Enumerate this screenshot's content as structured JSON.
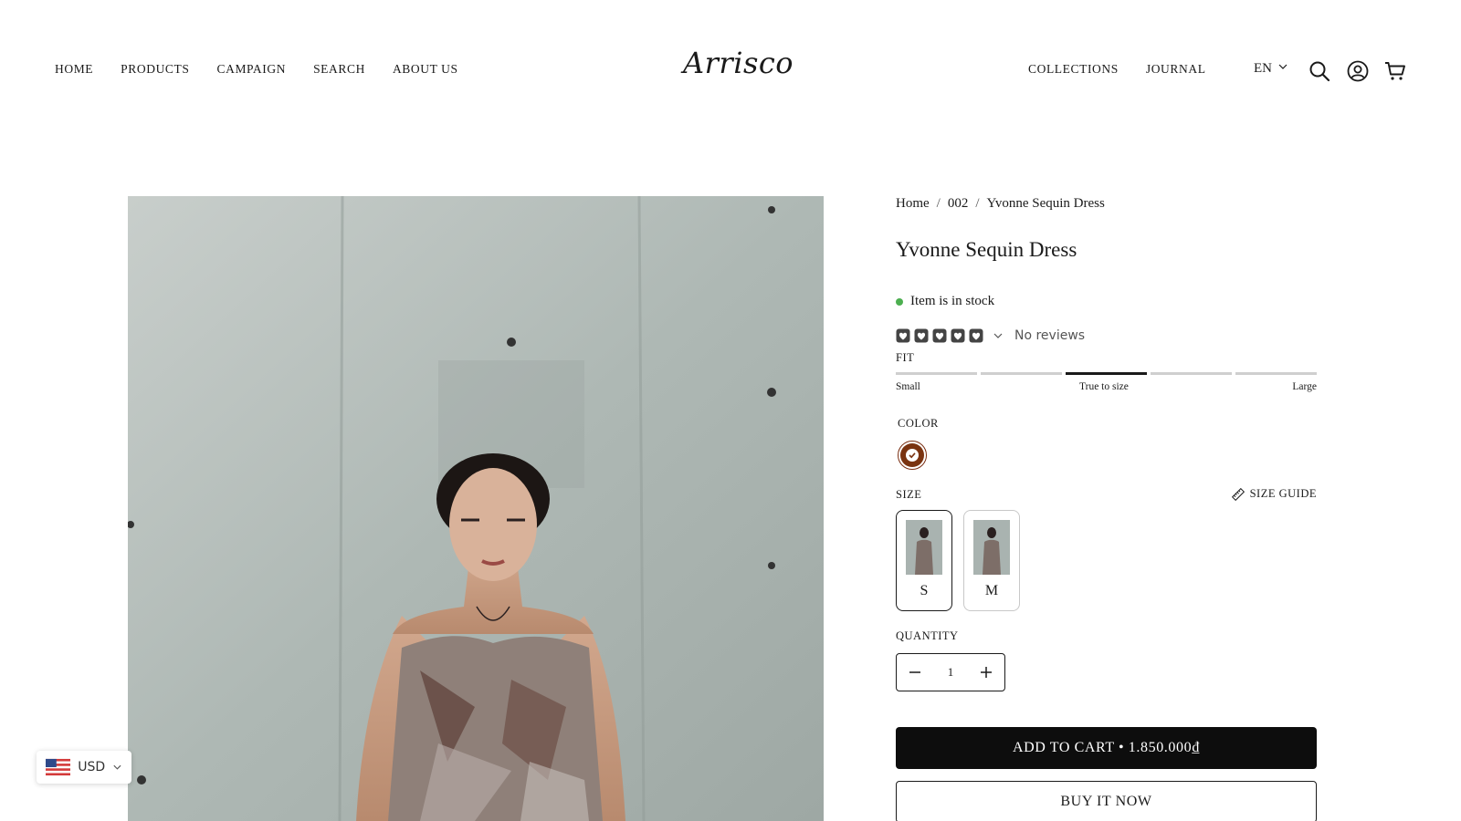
{
  "header": {
    "nav_left": [
      "HOME",
      "PRODUCTS",
      "CAMPAIGN",
      "SEARCH",
      "ABOUT US"
    ],
    "logo": "Arrisco",
    "nav_right": [
      "COLLECTIONS",
      "JOURNAL"
    ],
    "language": "EN",
    "icons": [
      "search-icon",
      "account-icon",
      "cart-icon"
    ]
  },
  "breadcrumb": {
    "home": "Home",
    "separator": "/",
    "collection": "002",
    "current": "Yvonne Sequin Dress"
  },
  "product": {
    "title": "Yvonne Sequin Dress",
    "stock_status": "Item is in stock",
    "rating_text": "No reviews",
    "rating_icon": "heart-icon",
    "fit": {
      "label": "FIT",
      "segments": 5,
      "selected_segment": 3,
      "scale_left": "Small",
      "scale_mid": "True to size",
      "scale_right": "Large"
    },
    "color": {
      "label": "COLOR",
      "swatch_hex": "#7a3310"
    },
    "size": {
      "label": "SIZE",
      "guide_label": "SIZE GUIDE",
      "options": [
        "S",
        "M"
      ],
      "selected": "S"
    },
    "quantity": {
      "label": "QUANTITY",
      "value": "1"
    },
    "add_to_cart": "ADD TO CART • 1.850.000₫",
    "buy_now": "BUY IT NOW"
  },
  "currency": {
    "code": "USD",
    "flag": "us-flag-icon"
  },
  "colors": {
    "accent": "#0d0d0d",
    "stock_dot": "#4caf50",
    "swatch": "#7a3310"
  }
}
